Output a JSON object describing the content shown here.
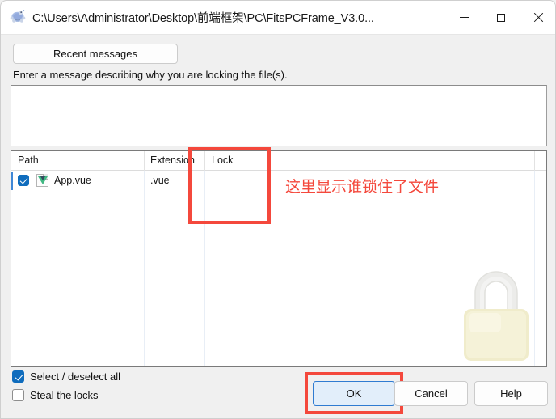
{
  "window": {
    "title": "C:\\Users\\Administrator\\Desktop\\前端框架\\PC\\FitsPCFrame_V3.0...",
    "app_icon": "tortoisesvn-turtle-icon",
    "controls": {
      "minimize": "minimize-icon",
      "maximize": "maximize-icon",
      "close": "close-icon"
    }
  },
  "toolbar": {
    "recent_messages_label": "Recent messages"
  },
  "message": {
    "prompt": "Enter a message describing why you are locking the file(s).",
    "value": "",
    "placeholder": ""
  },
  "file_list": {
    "columns": [
      {
        "key": "path",
        "label": "Path"
      },
      {
        "key": "extension",
        "label": "Extension"
      },
      {
        "key": "lock",
        "label": "Lock"
      }
    ],
    "rows": [
      {
        "checked": true,
        "file_icon": "vue-file-icon",
        "path": "App.vue",
        "extension": ".vue",
        "lock": ""
      }
    ],
    "watermark_icon": "padlock-watermark-icon"
  },
  "annotations": {
    "note_text": "这里显示谁锁住了文件",
    "note_color": "#f4483c",
    "boxes": [
      {
        "name": "lock-column-highlight",
        "color": "#f4483c"
      },
      {
        "name": "ok-button-highlight",
        "color": "#f4483c"
      }
    ]
  },
  "options": [
    {
      "label": "Select / deselect all",
      "checked": true
    },
    {
      "label": "Steal the locks",
      "checked": false
    }
  ],
  "buttons": {
    "ok": "OK",
    "cancel": "Cancel",
    "help": "Help"
  },
  "colors": {
    "accent": "#0f6cbd",
    "annotation": "#f4483c",
    "primary_button_bg": "#e2eefa",
    "vue_green": "#41b883"
  }
}
